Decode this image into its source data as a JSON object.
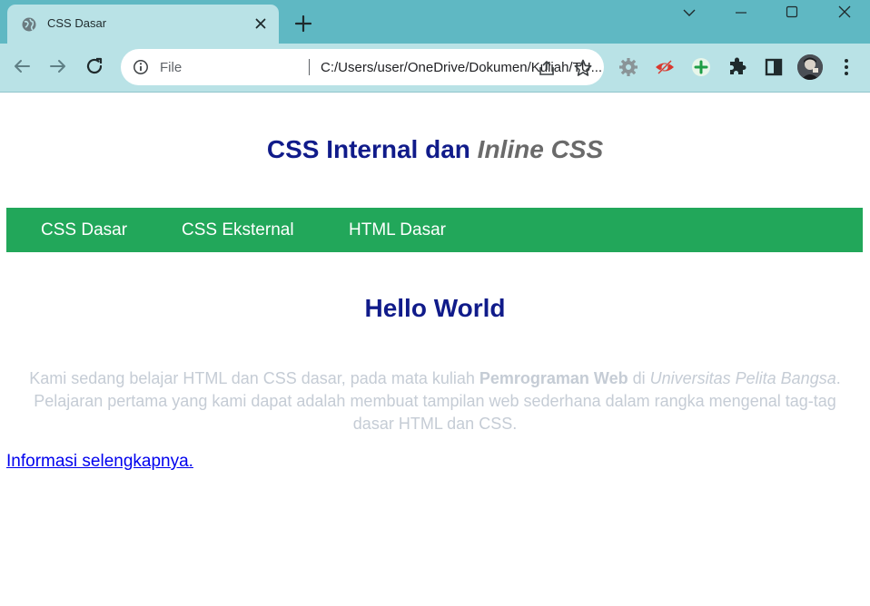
{
  "browser": {
    "tab": {
      "title": "CSS Dasar"
    },
    "omnibox": {
      "scheme": "File",
      "url": "C:/Users/user/OneDrive/Dokumen/Kuliah/TU..."
    }
  },
  "page": {
    "title_main": "CSS Internal dan ",
    "title_italic": "Inline CSS",
    "nav": {
      "items": [
        {
          "label": "CSS Dasar"
        },
        {
          "label": "CSS Eksternal"
        },
        {
          "label": "HTML Dasar"
        }
      ]
    },
    "heading": "Hello World",
    "paragraph": {
      "part1": "Kami sedang belajar HTML dan CSS dasar, pada mata kuliah ",
      "bold": "Pemrograman Web",
      "part2": " di ",
      "italic": "Universitas Pelita Bangsa",
      "part3": ". Pelajaran pertama yang kami dapat adalah membuat tampilan web sederhana dalam rangka mengenal tag-tag dasar HTML dan CSS."
    },
    "link": "Informasi selengkapnya."
  },
  "colors": {
    "tabstrip": "#5fb8c3",
    "toolbar": "#b9e2e6",
    "heading": "#101b8a",
    "navbar": "#22a75a",
    "paragraph": "#c5ccd5",
    "link": "#0000ee"
  }
}
